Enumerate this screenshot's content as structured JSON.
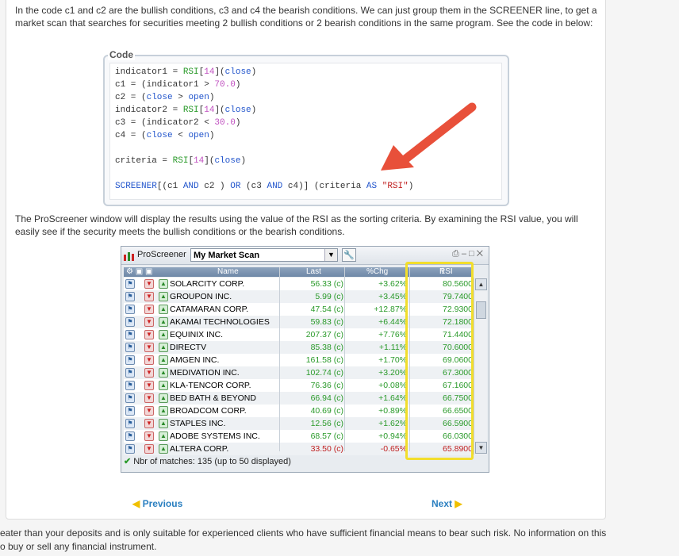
{
  "intro_text": "In the code c1 and c2 are the bullish conditions, c3 and c4 the bearish conditions. We can just group them in the SCREENER line, to get a market scan that searches for securities meeting 2 bullish conditions or 2 bearish conditions in the same program. See the code in below:",
  "code_label": "Code",
  "code_lines": [
    "indicator1 = RSI[14](close)",
    "c1 = (indicator1 > 70.0)",
    "c2 = (close > open)",
    "indicator2 = RSI[14](close)",
    "c3 = (indicator2 < 30.0)",
    "c4 = (close < open)",
    "",
    "criteria = RSI[14](close)",
    "",
    "SCREENER[(c1 AND c2 ) OR (c3 AND c4)] (criteria AS \"RSI\")"
  ],
  "result_text": "The ProScreener window will display the results using the value of the RSI as the sorting criteria. By examining the RSI value, you will easily see if the security meets the bullish conditions or the bearish conditions.",
  "screener": {
    "title": "ProScreener",
    "scan_name": "My Market Scan",
    "columns": {
      "name": "Name",
      "last": "Last",
      "chg": "%Chg",
      "rsi": "RSI"
    },
    "rows": [
      {
        "name": "SOLARCITY CORP.",
        "last": "56.33 (c)",
        "chg": "+3.62%",
        "rsi": "80.5600",
        "down": false
      },
      {
        "name": "GROUPON INC.",
        "last": "5.99 (c)",
        "chg": "+3.45%",
        "rsi": "79.7400",
        "down": false
      },
      {
        "name": "CATAMARAN CORP.",
        "last": "47.54 (c)",
        "chg": "+12.87%",
        "rsi": "72.9300",
        "down": false
      },
      {
        "name": "AKAMAI TECHNOLOGIES",
        "last": "59.83 (c)",
        "chg": "+6.44%",
        "rsi": "72.1800",
        "down": false
      },
      {
        "name": "EQUINIX INC.",
        "last": "207.37 (c)",
        "chg": "+7.76%",
        "rsi": "71.4400",
        "down": false
      },
      {
        "name": "DIRECTV",
        "last": "85.38 (c)",
        "chg": "+1.11%",
        "rsi": "70.6000",
        "down": false
      },
      {
        "name": "AMGEN INC.",
        "last": "161.58 (c)",
        "chg": "+1.70%",
        "rsi": "69.0600",
        "down": false
      },
      {
        "name": "MEDIVATION INC.",
        "last": "102.74 (c)",
        "chg": "+3.20%",
        "rsi": "67.3000",
        "down": false
      },
      {
        "name": "KLA-TENCOR CORP.",
        "last": "76.36 (c)",
        "chg": "+0.08%",
        "rsi": "67.1600",
        "down": false
      },
      {
        "name": "BED BATH & BEYOND",
        "last": "66.94 (c)",
        "chg": "+1.64%",
        "rsi": "66.7500",
        "down": false
      },
      {
        "name": "BROADCOM CORP.",
        "last": "40.69 (c)",
        "chg": "+0.89%",
        "rsi": "66.6500",
        "down": false
      },
      {
        "name": "STAPLES INC.",
        "last": "12.56 (c)",
        "chg": "+1.62%",
        "rsi": "66.5900",
        "down": false
      },
      {
        "name": "ADOBE SYSTEMS INC.",
        "last": "68.57 (c)",
        "chg": "+0.94%",
        "rsi": "66.0300",
        "down": false
      },
      {
        "name": "ALTERA CORP.",
        "last": "33.50 (c)",
        "chg": "-0.65%",
        "rsi": "65.8900",
        "down": true
      }
    ],
    "status": "Nbr of matches: 135 (up to 50 displayed)"
  },
  "nav": {
    "previous": "Previous",
    "next": "Next"
  },
  "footer_line1": "eater than your deposits and is only suitable for experienced clients who have sufficient financial means to bear such risk. No information on this",
  "footer_line2": "o buy or sell any financial instrument.",
  "colors": {
    "accent": "#2a7fc0",
    "highlight": "#f2de2c",
    "arrow": "#e8503a",
    "positive": "#2a9a2a",
    "negative": "#c02020"
  }
}
